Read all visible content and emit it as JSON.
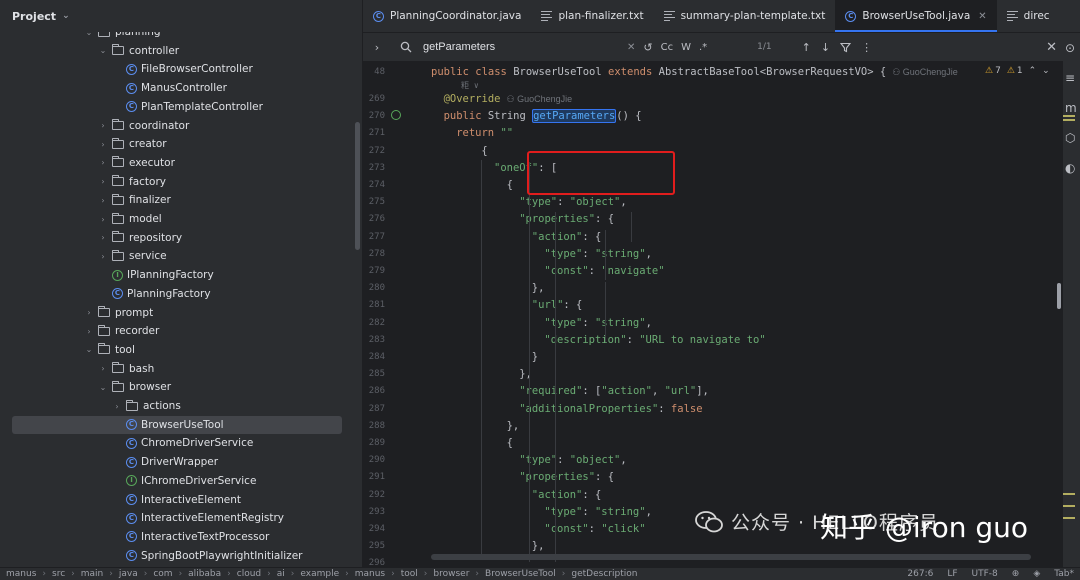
{
  "project": {
    "title": "Project",
    "tree": [
      {
        "label": "planning",
        "type": "folder",
        "depth": 3,
        "arrow": "v"
      },
      {
        "label": "controller",
        "type": "folder",
        "depth": 4,
        "arrow": "v"
      },
      {
        "label": "FileBrowserController",
        "type": "class",
        "depth": 5
      },
      {
        "label": "ManusController",
        "type": "class",
        "depth": 5
      },
      {
        "label": "PlanTemplateController",
        "type": "class",
        "depth": 5
      },
      {
        "label": "coordinator",
        "type": "folder",
        "depth": 4,
        "arrow": ">"
      },
      {
        "label": "creator",
        "type": "folder",
        "depth": 4,
        "arrow": ">"
      },
      {
        "label": "executor",
        "type": "folder",
        "depth": 4,
        "arrow": ">"
      },
      {
        "label": "factory",
        "type": "folder",
        "depth": 4,
        "arrow": ">"
      },
      {
        "label": "finalizer",
        "type": "folder",
        "depth": 4,
        "arrow": ">"
      },
      {
        "label": "model",
        "type": "folder",
        "depth": 4,
        "arrow": ">"
      },
      {
        "label": "repository",
        "type": "folder",
        "depth": 4,
        "arrow": ">"
      },
      {
        "label": "service",
        "type": "folder",
        "depth": 4,
        "arrow": ">"
      },
      {
        "label": "IPlanningFactory",
        "type": "interface",
        "depth": 4
      },
      {
        "label": "PlanningFactory",
        "type": "class",
        "depth": 4
      },
      {
        "label": "prompt",
        "type": "folder",
        "depth": 3,
        "arrow": ">"
      },
      {
        "label": "recorder",
        "type": "folder",
        "depth": 3,
        "arrow": ">"
      },
      {
        "label": "tool",
        "type": "folder",
        "depth": 3,
        "arrow": "v"
      },
      {
        "label": "bash",
        "type": "folder",
        "depth": 4,
        "arrow": ">"
      },
      {
        "label": "browser",
        "type": "folder",
        "depth": 4,
        "arrow": "v"
      },
      {
        "label": "actions",
        "type": "folder",
        "depth": 5,
        "arrow": ">"
      },
      {
        "label": "BrowserUseTool",
        "type": "class",
        "depth": 5,
        "selected": true
      },
      {
        "label": "ChromeDriverService",
        "type": "class",
        "depth": 5
      },
      {
        "label": "DriverWrapper",
        "type": "class",
        "depth": 5
      },
      {
        "label": "IChromeDriverService",
        "type": "interface",
        "depth": 5
      },
      {
        "label": "InteractiveElement",
        "type": "class",
        "depth": 5
      },
      {
        "label": "InteractiveElementRegistry",
        "type": "class",
        "depth": 5
      },
      {
        "label": "InteractiveTextProcessor",
        "type": "class",
        "depth": 5
      },
      {
        "label": "SpringBootPlaywrightInitializer",
        "type": "class",
        "depth": 5
      }
    ]
  },
  "tabs": [
    {
      "label": "PlanningCoordinator.java",
      "kind": "class"
    },
    {
      "label": "plan-finalizer.txt",
      "kind": "txt"
    },
    {
      "label": "summary-plan-template.txt",
      "kind": "txt"
    },
    {
      "label": "BrowserUseTool.java",
      "kind": "class",
      "active": true
    },
    {
      "label": "direc",
      "kind": "txt"
    }
  ],
  "search": {
    "query": "getParameters",
    "match_case_label": "Cc",
    "word_label": "W",
    "regex_label": ".*",
    "result_count": "1/1"
  },
  "editor": {
    "header_line_no": "48",
    "header_code": "public class BrowserUseTool extends AbstractBaseTool<BrowserRequestVO> {",
    "header_author": "GuoChengJie",
    "warnings": "7",
    "errors": "1",
    "usage_hint": "粔 ∨",
    "lines": [
      {
        "no": "269",
        "code": "@Override",
        "author": "GuoChengJie"
      },
      {
        "no": "270",
        "code": "public String getParameters() {"
      },
      {
        "no": "271",
        "code": "return \"\"\""
      },
      {
        "no": "272",
        "code": "{"
      },
      {
        "no": "273",
        "code": "\"oneOf\": ["
      },
      {
        "no": "274",
        "code": "{"
      },
      {
        "no": "275",
        "code": "\"type\": \"object\","
      },
      {
        "no": "276",
        "code": "\"properties\": {"
      },
      {
        "no": "277",
        "code": "\"action\": {"
      },
      {
        "no": "278",
        "code": "\"type\": \"string\","
      },
      {
        "no": "279",
        "code": "\"const\": \"navigate\""
      },
      {
        "no": "280",
        "code": "},"
      },
      {
        "no": "281",
        "code": "\"url\": {"
      },
      {
        "no": "282",
        "code": "\"type\": \"string\","
      },
      {
        "no": "283",
        "code": "\"description\": \"URL to navigate to\""
      },
      {
        "no": "284",
        "code": "}"
      },
      {
        "no": "285",
        "code": "},"
      },
      {
        "no": "286",
        "code": "\"required\": [\"action\", \"url\"],"
      },
      {
        "no": "287",
        "code": "\"additionalProperties\": false"
      },
      {
        "no": "288",
        "code": "},"
      },
      {
        "no": "289",
        "code": "{"
      },
      {
        "no": "290",
        "code": "\"type\": \"object\","
      },
      {
        "no": "291",
        "code": "\"properties\": {"
      },
      {
        "no": "292",
        "code": "\"action\": {"
      },
      {
        "no": "293",
        "code": "\"type\": \"string\","
      },
      {
        "no": "294",
        "code": "\"const\": \"click\""
      },
      {
        "no": "295",
        "code": "},"
      },
      {
        "no": "296",
        "code": ""
      }
    ]
  },
  "status_bar": {
    "breadcrumbs": [
      "manus",
      "src",
      "main",
      "java",
      "com",
      "alibaba",
      "cloud",
      "ai",
      "example",
      "manus",
      "tool",
      "browser",
      "BrowserUseTool",
      "getDescription"
    ],
    "position": "267:6",
    "line_sep": "LF",
    "encoding": "UTF-8",
    "indent": "Tab*"
  },
  "watermark": {
    "line1": "公众号 · HELLO程序员",
    "line2": "知乎 @iron guo"
  }
}
